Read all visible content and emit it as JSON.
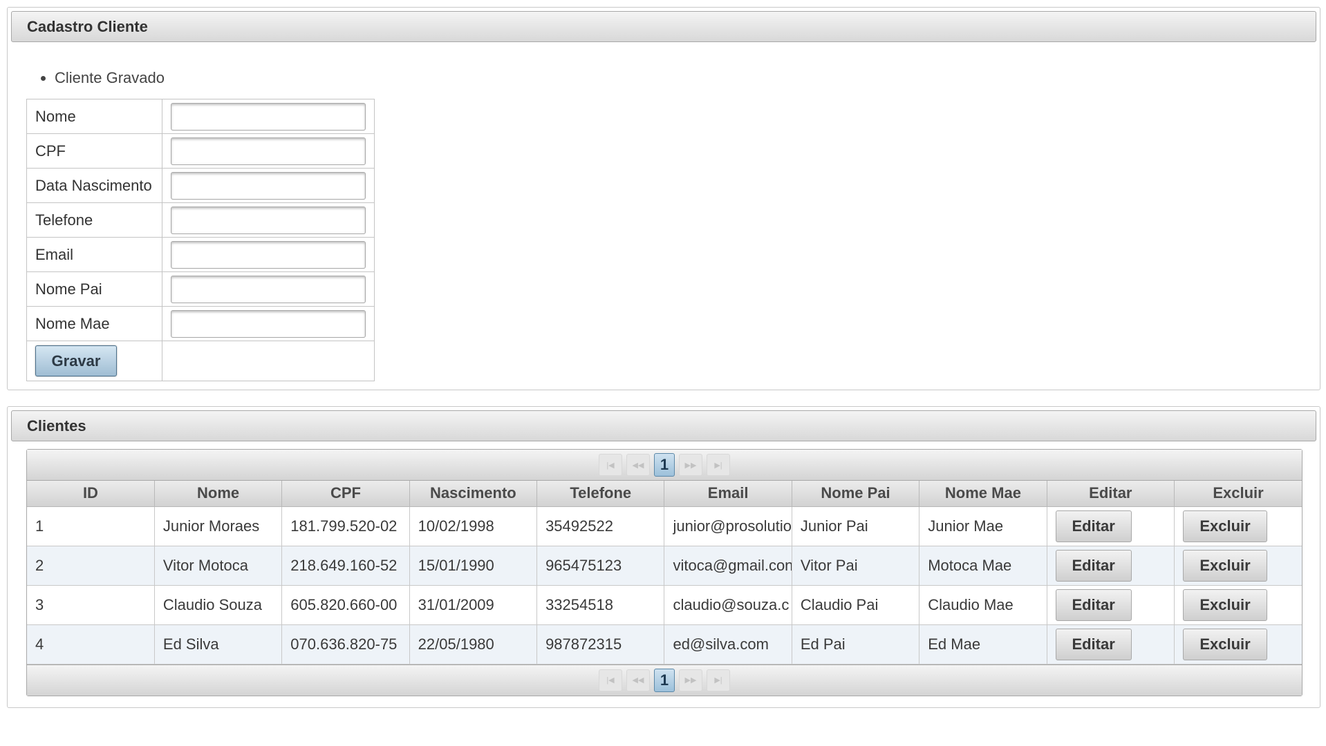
{
  "cadastro": {
    "title": "Cadastro Cliente",
    "message": "Cliente Gravado",
    "fields": [
      {
        "label": "Nome",
        "value": ""
      },
      {
        "label": "CPF",
        "value": ""
      },
      {
        "label": "Data Nascimento",
        "value": ""
      },
      {
        "label": "Telefone",
        "value": ""
      },
      {
        "label": "Email",
        "value": ""
      },
      {
        "label": "Nome Pai",
        "value": ""
      },
      {
        "label": "Nome Mae",
        "value": ""
      }
    ],
    "submit_label": "Gravar"
  },
  "clientes": {
    "title": "Clientes",
    "paginator": {
      "current_page": "1",
      "first_icon": "first-page-icon",
      "prev_icon": "prev-page-icon",
      "next_icon": "next-page-icon",
      "last_icon": "last-page-icon"
    },
    "columns": [
      "ID",
      "Nome",
      "CPF",
      "Nascimento",
      "Telefone",
      "Email",
      "Nome Pai",
      "Nome Mae",
      "Editar",
      "Excluir"
    ],
    "rows": [
      {
        "id": "1",
        "nome": "Junior Moraes",
        "cpf": "181.799.520-02",
        "nascimento": "10/02/1998",
        "telefone": "35492522",
        "email": "junior@prosolutio",
        "nome_pai": "Junior Pai",
        "nome_mae": "Junior Mae"
      },
      {
        "id": "2",
        "nome": "Vitor Motoca",
        "cpf": "218.649.160-52",
        "nascimento": "15/01/1990",
        "telefone": "965475123",
        "email": "vitoca@gmail.con",
        "nome_pai": "Vitor Pai",
        "nome_mae": "Motoca Mae"
      },
      {
        "id": "3",
        "nome": "Claudio Souza",
        "cpf": "605.820.660-00",
        "nascimento": "31/01/2009",
        "telefone": "33254518",
        "email": "claudio@souza.c",
        "nome_pai": "Claudio Pai",
        "nome_mae": "Claudio Mae"
      },
      {
        "id": "4",
        "nome": "Ed Silva",
        "cpf": "070.636.820-75",
        "nascimento": "22/05/1980",
        "telefone": "987872315",
        "email": "ed@silva.com",
        "nome_pai": "Ed Pai",
        "nome_mae": "Ed Mae"
      }
    ],
    "edit_label": "Editar",
    "delete_label": "Excluir"
  }
}
